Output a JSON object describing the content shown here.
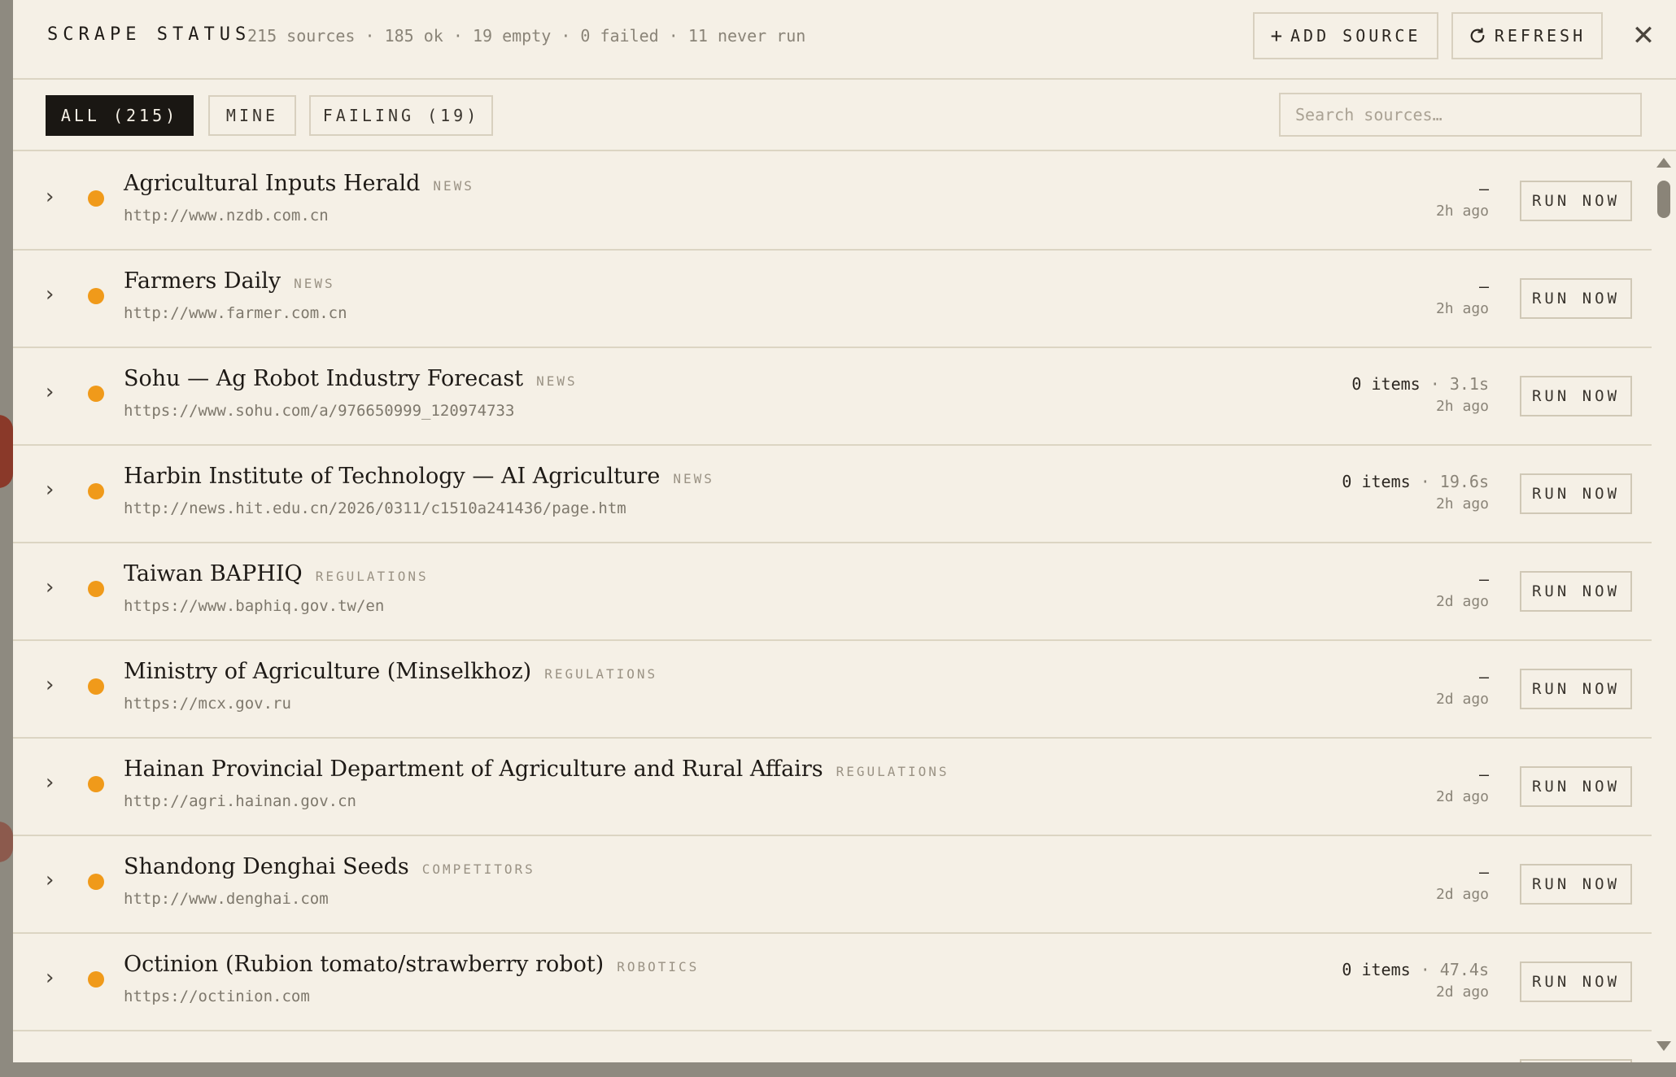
{
  "header": {
    "title": "SCRAPE STATUS",
    "summary": "215 sources · 185 ok · 19 empty · 0 failed · 11 never run",
    "add_source_label": "ADD SOURCE",
    "add_source_icon": "plus-icon",
    "refresh_label": "REFRESH",
    "refresh_icon": "refresh-icon",
    "close_icon": "close-icon"
  },
  "filters": {
    "tabs": [
      {
        "label": "ALL (215)",
        "active": true
      },
      {
        "label": "MINE",
        "active": false
      },
      {
        "label": "FAILING (19)",
        "active": false
      }
    ],
    "search_placeholder": "Search sources…"
  },
  "colors": {
    "status_empty": "#f09a1a",
    "active_tab": "#1a1713",
    "panel_bg": "#f5f0e6"
  },
  "run_label": "RUN NOW",
  "sources": [
    {
      "name": "Agricultural Inputs Herald",
      "tag": "NEWS",
      "url": "http://www.nzdb.com.cn",
      "items": "",
      "duration": "",
      "dash": "–",
      "ago": "2h ago"
    },
    {
      "name": "Farmers Daily",
      "tag": "NEWS",
      "url": "http://www.farmer.com.cn",
      "items": "",
      "duration": "",
      "dash": "–",
      "ago": "2h ago"
    },
    {
      "name": "Sohu — Ag Robot Industry Forecast",
      "tag": "NEWS",
      "url": "https://www.sohu.com/a/976650999_120974733",
      "items": "0 items",
      "duration": " · 3.1s",
      "dash": "",
      "ago": "2h ago"
    },
    {
      "name": "Harbin Institute of Technology — AI Agriculture",
      "tag": "NEWS",
      "url": "http://news.hit.edu.cn/2026/0311/c1510a241436/page.htm",
      "items": "0 items",
      "duration": " · 19.6s",
      "dash": "",
      "ago": "2h ago"
    },
    {
      "name": "Taiwan BAPHIQ",
      "tag": "REGULATIONS",
      "url": "https://www.baphiq.gov.tw/en",
      "items": "",
      "duration": "",
      "dash": "–",
      "ago": "2d ago"
    },
    {
      "name": "Ministry of Agriculture (Minselkhoz)",
      "tag": "REGULATIONS",
      "url": "https://mcx.gov.ru",
      "items": "",
      "duration": "",
      "dash": "–",
      "ago": "2d ago"
    },
    {
      "name": "Hainan Provincial Department of Agriculture and Rural Affairs",
      "tag": "REGULATIONS",
      "url": "http://agri.hainan.gov.cn",
      "items": "",
      "duration": "",
      "dash": "–",
      "ago": "2d ago"
    },
    {
      "name": "Shandong Denghai Seeds",
      "tag": "COMPETITORS",
      "url": "http://www.denghai.com",
      "items": "",
      "duration": "",
      "dash": "–",
      "ago": "2d ago"
    },
    {
      "name": "Octinion (Rubion tomato/strawberry robot)",
      "tag": "ROBOTICS",
      "url": "https://octinion.com",
      "items": "0 items",
      "duration": " · 47.4s",
      "dash": "",
      "ago": "2d ago"
    }
  ]
}
